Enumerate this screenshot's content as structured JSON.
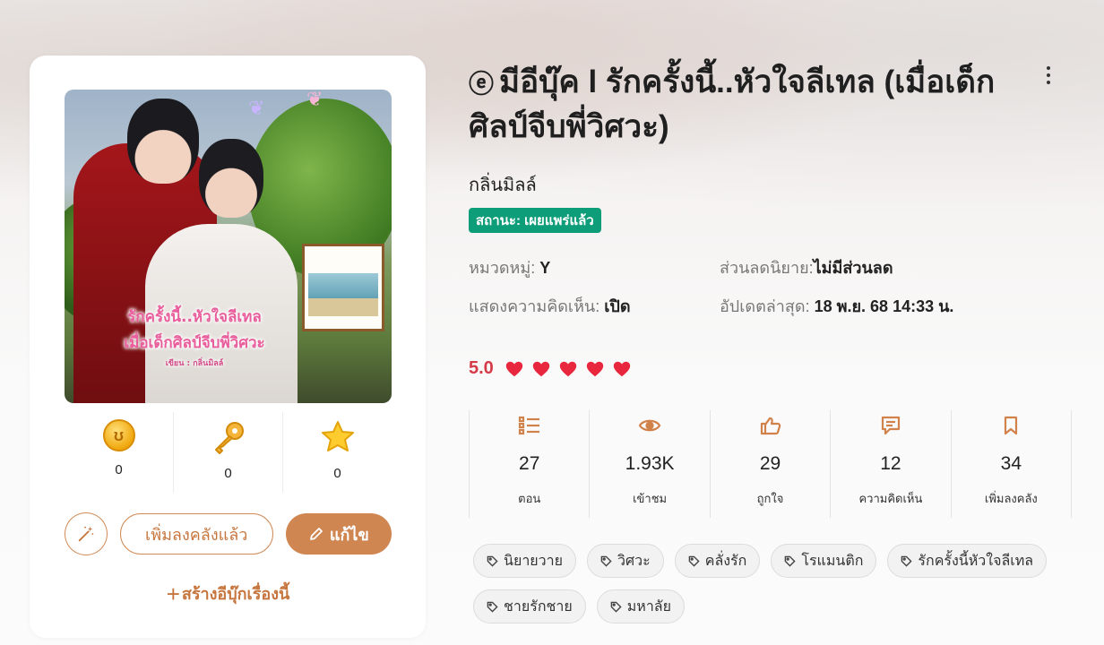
{
  "book": {
    "ebook_mark": "ⓔ",
    "title": "มีอีบุ๊ค l รักครั้งนี้..หัวใจลีเทล (เมื่อเด็กศิลป์จีบพี่วิศวะ)",
    "author": "กลิ่นมิลล์",
    "status": "สถานะ: เผยแพร่แล้ว",
    "cover_art": {
      "line1": "รักครั้งนี้..หัวใจลีเทล",
      "line2": "เมื่อเด็กศิลป์จีบพี่วิศวะ",
      "line3": "เขียน : กลิ่นมิลล์"
    }
  },
  "card_stats": [
    {
      "icon": "coin-icon",
      "value": "0"
    },
    {
      "icon": "key-icon",
      "value": "0"
    },
    {
      "icon": "star-icon",
      "value": "0"
    }
  ],
  "buttons": {
    "library": "เพิ่มลงคลังแล้ว",
    "edit": "แก้ไข",
    "create_ebook": "สร้างอีบุ๊กเรื่องนี้"
  },
  "meta": {
    "category_label": "หมวดหมู่:",
    "category_value": "Y",
    "discount_label": "ส่วนลดนิยาย:",
    "discount_value": "ไม่มีส่วนลด",
    "comments_label": "แสดงความคิดเห็น:",
    "comments_value": "เปิด",
    "updated_label": "อัปเดตล่าสุด:",
    "updated_value": "18 พ.ย. 68 14:33 น."
  },
  "rating": {
    "score": "5.0",
    "hearts": 5,
    "color": "#e8273e"
  },
  "stats": [
    {
      "icon": "list-icon",
      "value": "27",
      "label": "ตอน"
    },
    {
      "icon": "eye-icon",
      "value": "1.93K",
      "label": "เข้าชม"
    },
    {
      "icon": "thumb-up-icon",
      "value": "29",
      "label": "ถูกใจ"
    },
    {
      "icon": "comment-icon",
      "value": "12",
      "label": "ความคิดเห็น"
    },
    {
      "icon": "bookmark-icon",
      "value": "34",
      "label": "เพิ่มลงคลัง"
    }
  ],
  "tags": [
    "นิยายวาย",
    "วิศวะ",
    "คลั่งรัก",
    "โรแมนติก",
    "รักครั้งนี้หัวใจลีเทล",
    "ชายรักชาย",
    "มหาลัย"
  ],
  "colors": {
    "accent": "#cf8651",
    "status": "#0e9d79",
    "rating": "#d43a48"
  }
}
